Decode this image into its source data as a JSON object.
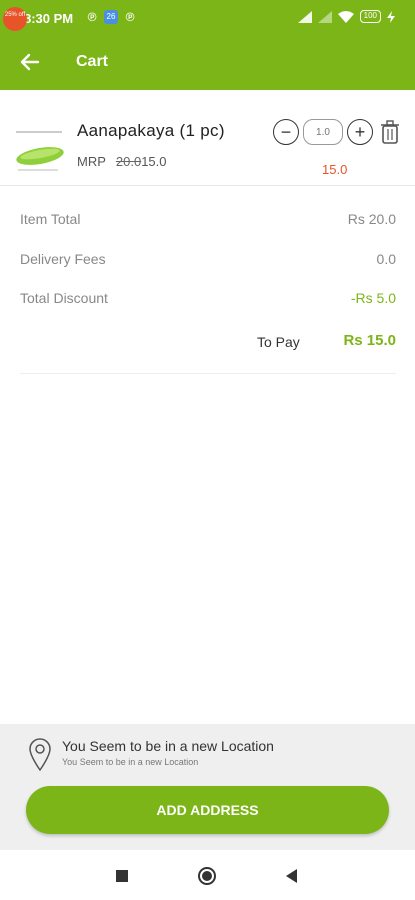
{
  "status_bar": {
    "time": "8:30 PM",
    "left_icons": [
      "p-icon",
      "app-badge-icon",
      "p-icon"
    ],
    "app_badge_text": "26",
    "battery": "100"
  },
  "appbar": {
    "title": "Cart",
    "back_icon": "arrow-left-icon",
    "color": "#7cb518"
  },
  "cart_item": {
    "name": "Aanapakaya (1 pc)",
    "discount_badge": "25% off",
    "mrp_label": "MRP",
    "mrp_original": "20.0",
    "mrp_price": "15.0",
    "quantity_placeholder": "1.0",
    "line_total": "15.0"
  },
  "bill": {
    "item_total_label": "Item Total",
    "item_total_value": "Rs 20.0",
    "delivery_label": "Delivery Fees",
    "delivery_value": "0.0",
    "discount_label": "Total Discount",
    "discount_value": "-Rs 5.0",
    "to_pay_label": "To Pay",
    "to_pay_value": "Rs 15.0"
  },
  "location": {
    "title": "You Seem to be in a new Location",
    "subtitle": "You Seem to be in a new Location",
    "button_label": "ADD ADDRESS"
  },
  "colors": {
    "accent": "#7cb518",
    "discount": "#e8542a"
  }
}
